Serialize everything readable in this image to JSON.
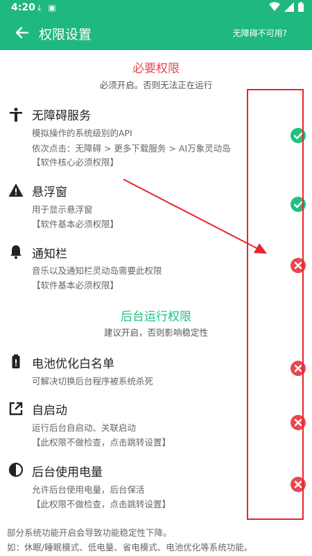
{
  "status_bar": {
    "time": "4:20"
  },
  "app_bar": {
    "title": "权限设置",
    "help_link": "无障碍不可用?"
  },
  "required_section": {
    "title": "必要权限",
    "subtitle": "必须开启。否则无法正在运行"
  },
  "background_section": {
    "title": "后台运行权限",
    "subtitle": "建议开启，否则影响稳定性"
  },
  "permissions": [
    {
      "name": "无障碍服务",
      "lines": [
        "模拟操作的系统级别的API",
        "依次点击：无障碍 > 更多下载服务 > AI万象灵动岛",
        "【软件核心必须权限】"
      ],
      "granted": true,
      "icon": "accessibility-icon"
    },
    {
      "name": "悬浮窗",
      "lines": [
        "用于显示悬浮窗",
        "【软件基本必须权限】"
      ],
      "granted": true,
      "icon": "warning-triangle-icon"
    },
    {
      "name": "通知栏",
      "lines": [
        "音乐以及通知栏灵动岛需要此权限",
        "【软件基本必须权限】"
      ],
      "granted": false,
      "icon": "bell-icon"
    },
    {
      "name": "电池优化白名单",
      "lines": [
        "可解决切换后台程序被系统杀死"
      ],
      "granted": false,
      "icon": "battery-icon"
    },
    {
      "name": "自启动",
      "lines": [
        "运行后台自启动、关联启动",
        "【此权限不做检查，点击跳转设置】"
      ],
      "granted": false,
      "icon": "open-external-icon"
    },
    {
      "name": "后台使用电量",
      "lines": [
        "允许后台使用电量，后台保活",
        "【此权限不做检查，点击跳转设置】"
      ],
      "granted": false,
      "icon": "contrast-icon"
    }
  ],
  "footer": {
    "line1": "部分系统功能开启会导致功能稳定性下降。",
    "line2": "如：休眠/睡眠模式、低电量、省电模式、电池优化等系统功能。"
  },
  "colors": {
    "primary": "#1fb87f",
    "required_title": "#e8474f",
    "background_title": "#22c07f",
    "granted": "#22c07f",
    "denied": "#e8474f",
    "annotation": "#e8232c"
  }
}
